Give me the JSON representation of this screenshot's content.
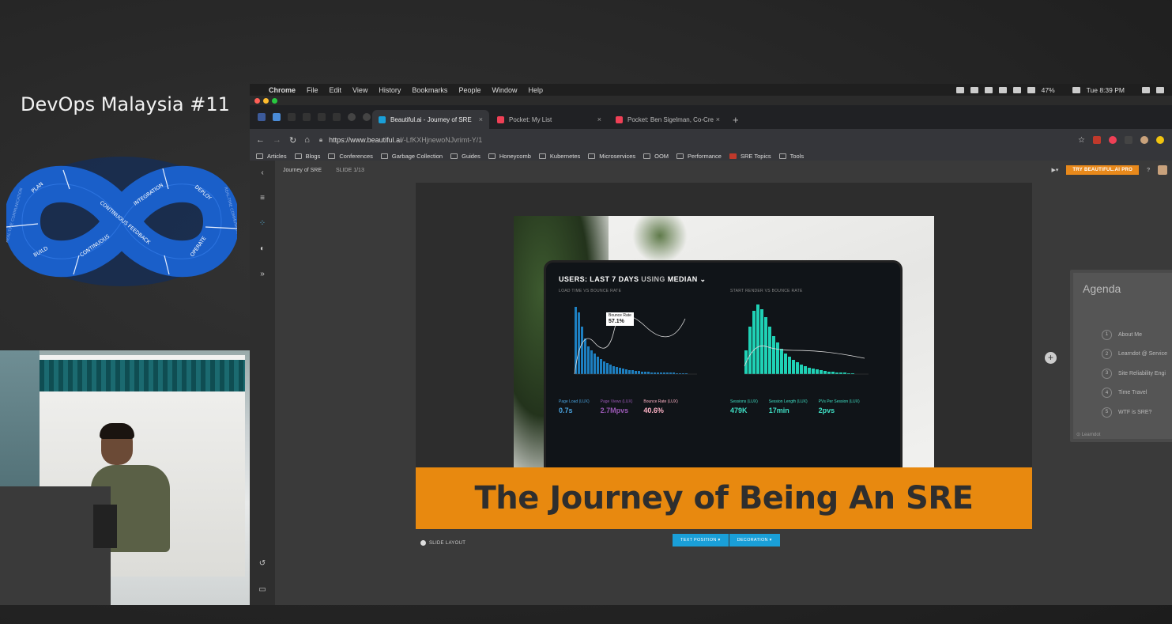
{
  "event": {
    "title": "DevOps Malaysia #11"
  },
  "logo": {
    "phases": [
      "PLAN",
      "INTEGRATION",
      "DEPLOY",
      "BUILD",
      "CONTINUOUS",
      "CONTINUOUS FEEDBACK",
      "OPERATE"
    ],
    "ring_text_left": "REAL-TIME COMMUNICATION",
    "ring_text_right": "REAL-TIME COMMUNICATION",
    "colors": {
      "blue": "#1a5fc9",
      "dark": "#0e2d63"
    }
  },
  "menubar": {
    "app": "Chrome",
    "items": [
      "File",
      "Edit",
      "View",
      "History",
      "Bookmarks",
      "People",
      "Window",
      "Help"
    ],
    "battery": "47%",
    "clock": "Tue 8:39 PM"
  },
  "tabs": [
    {
      "label": "Beautiful.ai - Journey of SRE",
      "active": true,
      "favicon_color": "#1a9fd8"
    },
    {
      "label": "Pocket: My List",
      "active": false,
      "favicon_color": "#ef4056"
    },
    {
      "label": "Pocket: Ben Sigelman, Co-Cre",
      "active": false,
      "favicon_color": "#ef4056"
    }
  ],
  "address": {
    "scheme_host": "https://www.beautiful.ai",
    "path": "/-LfKXHjnewoNJvrimt-Y/1"
  },
  "bookmarks": [
    "Articles",
    "Blogs",
    "Conferences",
    "Garbage Collection",
    "Guides",
    "Honeycomb",
    "Kubernetes",
    "Microservices",
    "OOM",
    "Performance",
    "SRE Topics",
    "Tools"
  ],
  "app": {
    "deck_name": "Journey of SRE",
    "slide_indicator": "SLIDE 1/13",
    "pro_button": "TRY BEAUTIFUL.AI PRO",
    "help": "?",
    "slide_layout": "SLIDE LAYOUT",
    "text_position": "TEXT POSITION ▾",
    "decoration": "DECORATION ▾"
  },
  "slide": {
    "title": "The Journey of Being An SRE",
    "banner_color": "#e8890f",
    "photo_dashboard": {
      "heading_bold": "USERS: LAST 7 DAYS",
      "heading_muted": "USING",
      "heading_end": "MEDIAN",
      "panel_left": "LOAD TIME VS BOUNCE RATE",
      "panel_right": "START RENDER VS BOUNCE RATE",
      "options": "OPTIONS",
      "tooltip_label": "Bounce Rate",
      "tooltip_value": "57.1%",
      "section_left": "PAGE VIEWS VS ONLOAD",
      "section_right": "SESSIONS",
      "metrics": [
        {
          "label": "Page Load (LUX)",
          "value": "0.7s",
          "color": "#4aa3df"
        },
        {
          "label": "Page Views (LUX)",
          "value": "2.7Mpvs",
          "color": "#9b59b6"
        },
        {
          "label": "Bounce Rate (LUX)",
          "value": "40.6%",
          "color": "#ffb3c6"
        },
        {
          "label": "Sessions (LUX)",
          "value": "479K",
          "color": "#3fe0c5"
        },
        {
          "label": "Session Length (LUX)",
          "value": "17min",
          "color": "#3fe0c5"
        },
        {
          "label": "PVs Per Session (LUX)",
          "value": "2pvs",
          "color": "#3fe0c5"
        }
      ]
    }
  },
  "next_slide": {
    "title": "Agenda",
    "items": [
      "About Me",
      "Learndot @ Service",
      "Site Reliability Engi",
      "Time Travel",
      "WTF is SRE?"
    ],
    "footer": "Learndot"
  }
}
